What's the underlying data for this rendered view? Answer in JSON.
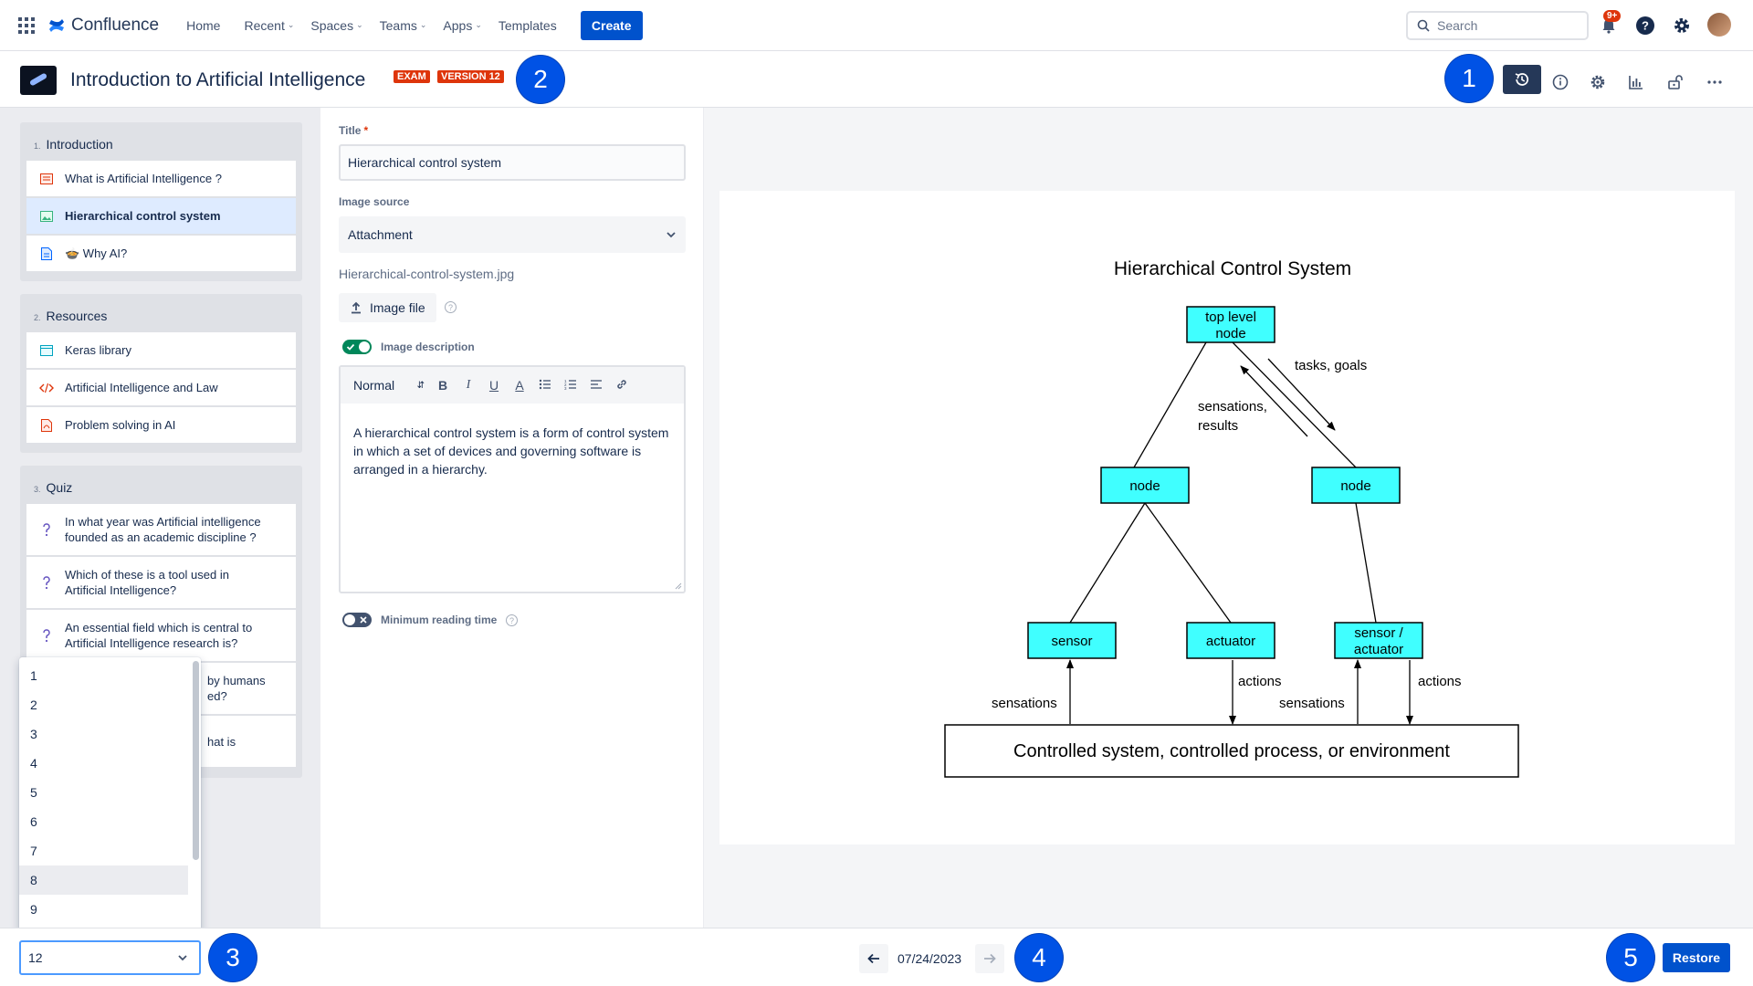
{
  "topnav": {
    "brand": "Confluence",
    "items": [
      {
        "label": "Home",
        "caret": false
      },
      {
        "label": "Recent",
        "caret": true
      },
      {
        "label": "Spaces",
        "caret": true
      },
      {
        "label": "Teams",
        "caret": true
      },
      {
        "label": "Apps",
        "caret": true
      },
      {
        "label": "Templates",
        "caret": false
      }
    ],
    "create": "Create",
    "search_placeholder": "Search",
    "notification_count": "9+"
  },
  "header": {
    "title": "Introduction to Artificial Intelligence",
    "badge_exam": "EXAM",
    "badge_version": "VERSION 12"
  },
  "callouts": [
    "1",
    "2",
    "3",
    "4",
    "5"
  ],
  "sidebar": {
    "sections": [
      {
        "num": "1.",
        "title": "Introduction",
        "items": [
          {
            "label": "What is Artificial Intelligence ?",
            "icon": "slides-icon"
          },
          {
            "label": "Hierarchical control system",
            "icon": "image-icon"
          },
          {
            "label": "🍲 Why AI?",
            "icon": "document-icon"
          }
        ]
      },
      {
        "num": "2.",
        "title": "Resources",
        "items": [
          {
            "label": "Keras library",
            "icon": "browser-icon"
          },
          {
            "label": "Artificial Intelligence and Law",
            "icon": "code-icon"
          },
          {
            "label": "Problem solving in AI",
            "icon": "pdf-icon"
          }
        ]
      },
      {
        "num": "3.",
        "title": "Quiz",
        "items": [
          {
            "label_1": "In what year was Artificial intelligence",
            "label_2": "founded as an academic discipline ?"
          },
          {
            "label_1": "Which of these is a tool used in",
            "label_2": "Artificial Intelligence?"
          },
          {
            "label_1": "An essential field which is central to",
            "label_2": "Artificial Intelligence research is?"
          },
          {
            "label_1": "by humans",
            "label_2": "ed?"
          },
          {
            "label_1": "hat is",
            "label_2": ""
          }
        ]
      }
    ]
  },
  "form": {
    "title_label": "Title",
    "title_value": "Hierarchical control system",
    "image_source_label": "Image source",
    "image_source_value": "Attachment",
    "filename": "Hierarchical-control-system.jpg",
    "upload_label": "Image file",
    "image_description_label": "Image description",
    "image_description_on": true,
    "toolbar_style": "Normal",
    "description_lines": [
      "A hierarchical control system is a form of control system",
      "in which a set of devices and governing software is",
      "arranged in a hierarchy."
    ],
    "min_reading_label": "Minimum reading time",
    "min_reading_on": false
  },
  "diagram": {
    "title": "Hierarchical Control System",
    "nodes": {
      "top_line1": "top level",
      "top_line2": "node",
      "node_left": "node",
      "node_right": "node",
      "sensor": "sensor",
      "actuator": "actuator",
      "sensor_actuator_line1": "sensor /",
      "sensor_actuator_line2": "actuator"
    },
    "labels": {
      "tasks_goals": "tasks, goals",
      "sensations_results_1": "sensations,",
      "sensations_results_2": "results",
      "sensations_left": "sensations",
      "actions_mid": "actions",
      "sensations_right": "sensations",
      "actions_right": "actions"
    },
    "environment": "Controlled system, controlled process, or environment",
    "node_color": "#40ffff"
  },
  "version_dropdown": {
    "options": [
      "1",
      "2",
      "3",
      "4",
      "5",
      "6",
      "7",
      "8",
      "9"
    ],
    "hovered": "8",
    "selected": "12"
  },
  "bottom": {
    "date": "07/24/2023",
    "restore": "Restore"
  },
  "colors": {
    "primary": "#0052cc",
    "callout": "#0052e5",
    "danger": "#de350b",
    "success": "#00875a"
  }
}
